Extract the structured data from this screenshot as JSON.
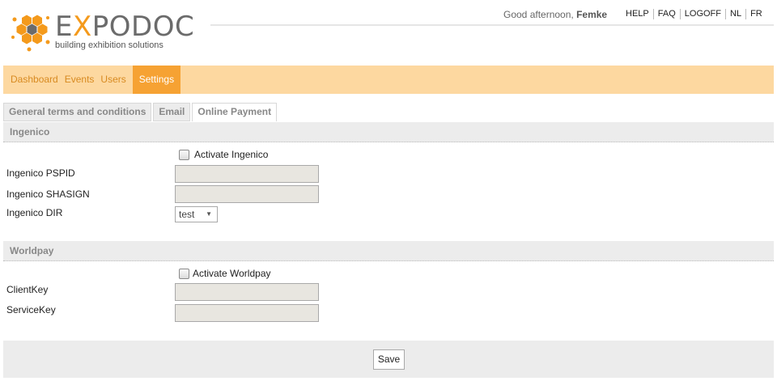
{
  "logo": {
    "title_first": "E",
    "title_accent": "X",
    "title_rest": "PODOC",
    "subtitle": "building exhibition solutions"
  },
  "header": {
    "greeting_prefix": "Good afternoon,",
    "greeting_name": "Femke",
    "links": [
      "HELP",
      "FAQ",
      "LOGOFF",
      "NL",
      "FR"
    ]
  },
  "nav": {
    "items": [
      "Dashboard",
      "Events",
      "Users",
      "Settings"
    ],
    "active": "Settings"
  },
  "tabs": {
    "items": [
      "General terms and conditions",
      "Email",
      "Online Payment"
    ],
    "active": "Online Payment"
  },
  "ingenico": {
    "heading": "Ingenico",
    "activate_label": "Activate Ingenico",
    "pspid_label": "Ingenico PSPID",
    "shasign_label": "Ingenico SHASIGN",
    "dir_label": "Ingenico DIR",
    "dir_value": "test",
    "pspid_value": "",
    "shasign_value": ""
  },
  "worldpay": {
    "heading": "Worldpay",
    "activate_label": "Activate Worldpay",
    "clientkey_label": "ClientKey",
    "servicekey_label": "ServiceKey",
    "clientkey_value": "",
    "servicekey_value": ""
  },
  "footer": {
    "save_label": "Save"
  },
  "colors": {
    "accent": "#f6a233",
    "nav_bg": "#fdd8a0",
    "nav_text": "#d88a20",
    "section_bg": "#ececec"
  }
}
